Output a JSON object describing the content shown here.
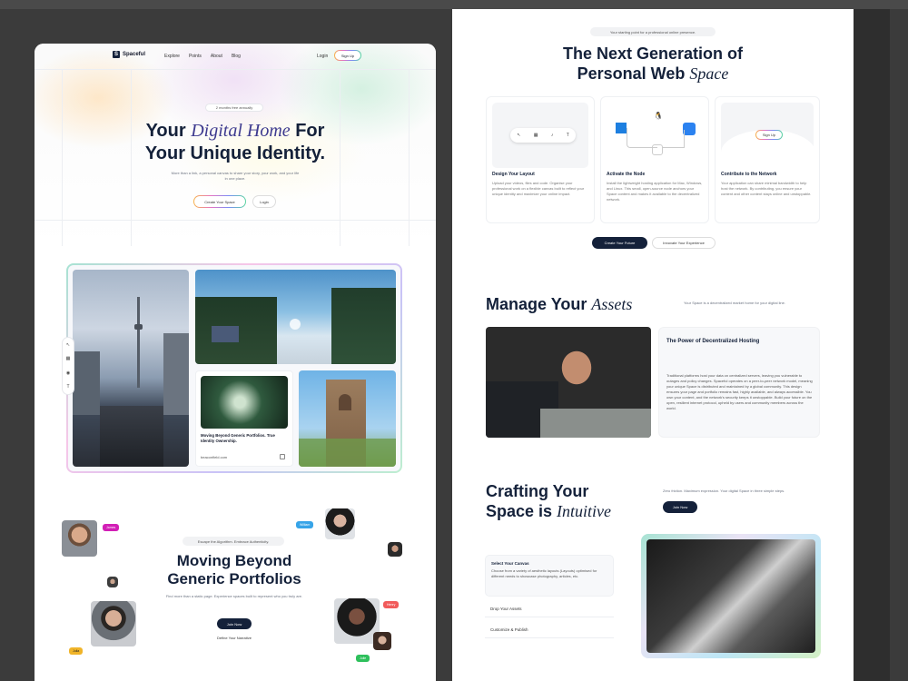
{
  "left": {
    "brand": "Spaceful",
    "nav": [
      "Explore",
      "Points",
      "About",
      "Blog"
    ],
    "login": "Login",
    "signup": "Sign Up",
    "badge": "2 months free annually",
    "hero_title_1": "Your ",
    "hero_title_italic": "Digital Home",
    "hero_title_2": " For",
    "hero_title_3": "Your Unique Identity.",
    "hero_sub": "More than a link, a personal canvas to share your story, your work, and your life in one place.",
    "cta_create": "Create Your Space",
    "cta_login": "Login",
    "gallery_card_title": "Moving Beyond Generic Portfolios. True Identity Ownership.",
    "gallery_card_link": "beaconfield.com",
    "pill2": "Escape the Algorithm. Embrace Authenticity.",
    "section_title_1": "Moving Beyond",
    "section_title_2": "Generic Portfolios",
    "section_sub": "Find more than a static page. Experience spaces built to represent who you truly are.",
    "join": "Join Now",
    "define": "Define Your Narrative",
    "tags": [
      "James",
      "William",
      "Henry",
      "Julia",
      "Julie"
    ]
  },
  "right": {
    "pill": "Your starting point for a professional online presence.",
    "title_1": "The Next Generation of",
    "title_2": "Personal Web ",
    "title_italic": "Space",
    "cards": [
      {
        "title": "Design Your Layout",
        "text": "Upload your videos, files and code. Organise your professional work on a flexible canvas built to reflect your unique identity and maximize your online impact."
      },
      {
        "title": "Activate the Node",
        "text": "Install the lightweight hosting application for Mac, Windows, and Linux. This small, open-source node anchors your Space content and makes it available to the decentralized network."
      },
      {
        "title": "Contribute to the Network",
        "text": "Your application can share minimal bandwidth to help host the network. By contributing, you ensure your content and other content stays online and unstoppable."
      }
    ],
    "card3_btn": "Sign Up",
    "btn_future": "Create Your Future",
    "btn_explore": "Innovate Your Experience",
    "assets_title": "Manage Your ",
    "assets_italic": "Assets",
    "assets_side": "Your Space is a decentralized market home for your digital line.",
    "power_title": "The Power of Decentralized Hosting",
    "power_text": "Traditional platforms host your data on centralized servers, leaving you vulnerable to outages and policy changes. Spaceful operates on a peer-to-peer network model, meaning your unique Space is distributed and maintained by a global community. This design ensures your page and portfolio remains fast, highly available, and always accessible. You own your content, and the network's security keeps it unstoppable. Build your future on the open, resilient internet protocol, upheld by users and community members across the world.",
    "craft_1": "Crafting Your",
    "craft_2": "Space is ",
    "craft_italic": "Intuitive",
    "craft_side": "Zero friction. Maximum expression. Your digital Space in three simple steps.",
    "join": "Join Now",
    "steps": [
      {
        "title": "Select Your Canvas",
        "text": "Choose from a variety of aesthetic layouts (Layouts) optimised for different needs to showcase photography, articles, etc."
      },
      {
        "title": "Drop Your Assets",
        "text": ""
      },
      {
        "title": "Customize & Publish",
        "text": ""
      }
    ],
    "toolbar_icons": [
      "pointer-icon",
      "grid-icon",
      "music-icon",
      "text-icon"
    ]
  }
}
